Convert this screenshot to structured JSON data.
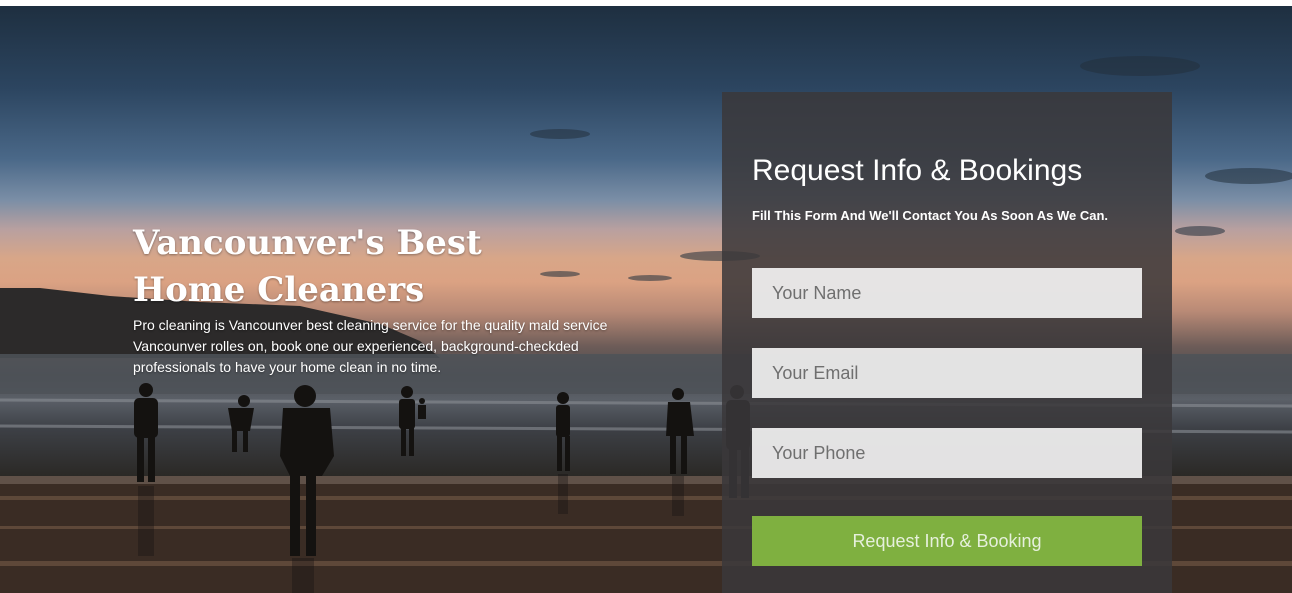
{
  "hero": {
    "headline_line1": "Vancounver's Best",
    "headline_line2": "Home Cleaners",
    "description": "Pro cleaning is Vancounver best cleaning service for the quality mald service Vancounver rolles on, book one our experienced, background-checkded professionals to have your home clean in no time."
  },
  "form": {
    "title": "Request Info & Bookings",
    "subtitle": "Fill This Form And We'll Contact You As Soon As We Can.",
    "name_placeholder": "Your Name",
    "email_placeholder": "Your Email",
    "phone_placeholder": "Your Phone",
    "submit_label": "Request Info & Booking"
  },
  "colors": {
    "panel_background": "#3a383a",
    "submit_button": "#7fb040",
    "field_background": "#fafafa",
    "text": "#ffffff"
  }
}
